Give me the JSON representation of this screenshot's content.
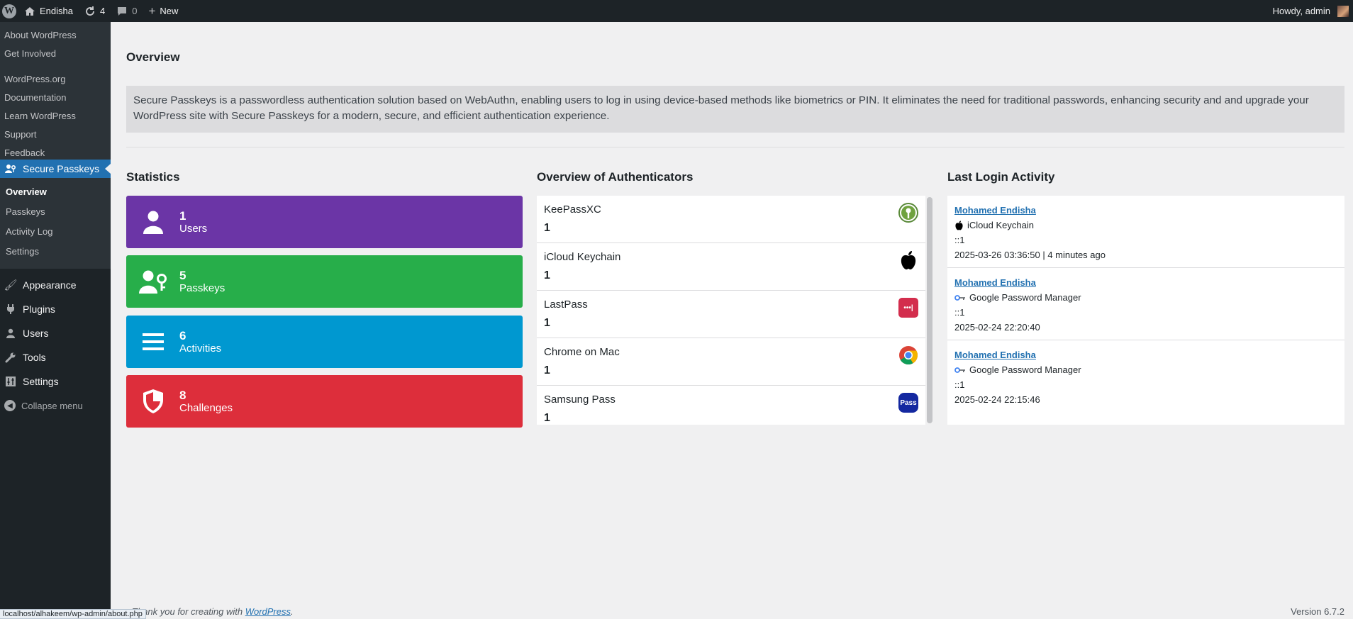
{
  "adminbar": {
    "site_name": "Endisha",
    "updates_count": "4",
    "comments_count": "0",
    "new_label": "New",
    "howdy": "Howdy, admin"
  },
  "sidebar": {
    "top_links": [
      "About WordPress",
      "Get Involved",
      "WordPress.org",
      "Documentation",
      "Learn WordPress",
      "Support",
      "Feedback"
    ],
    "active": "Secure Passkeys",
    "submenu": [
      "Overview",
      "Passkeys",
      "Activity Log",
      "Settings"
    ],
    "menu": [
      "Appearance",
      "Plugins",
      "Users",
      "Tools",
      "Settings"
    ],
    "collapse": "Collapse menu"
  },
  "page": {
    "title": "Overview",
    "description": "Secure Passkeys is a passwordless authentication solution based on WebAuthn, enabling users to log in using device-based methods like biometrics or PIN. It eliminates the need for traditional passwords, enhancing security and and upgrade your WordPress site with Secure Passkeys for a modern, secure, and efficient authentication experience."
  },
  "statistics": {
    "title": "Statistics",
    "cards": [
      {
        "value": "1",
        "label": "Users",
        "color": "#6b35a6",
        "icon": "user-icon"
      },
      {
        "value": "5",
        "label": "Passkeys",
        "color": "#27ae4a",
        "icon": "user-key-icon"
      },
      {
        "value": "6",
        "label": "Activities",
        "color": "#0098d0",
        "icon": "list-icon"
      },
      {
        "value": "8",
        "label": "Challenges",
        "color": "#dd2e3b",
        "icon": "shield-icon"
      }
    ]
  },
  "authenticators": {
    "title": "Overview of Authenticators",
    "items": [
      {
        "name": "KeePassXC",
        "count": "1",
        "icon": "keepassxc-icon"
      },
      {
        "name": "iCloud Keychain",
        "count": "1",
        "icon": "apple-icon"
      },
      {
        "name": "LastPass",
        "count": "1",
        "icon": "lastpass-icon",
        "icon_text": "•••|"
      },
      {
        "name": "Chrome on Mac",
        "count": "1",
        "icon": "chrome-icon"
      },
      {
        "name": "Samsung Pass",
        "count": "1",
        "icon": "samsung-pass-icon",
        "icon_text": "Pass"
      }
    ]
  },
  "last_login": {
    "title": "Last Login Activity",
    "items": [
      {
        "user": "Mohamed Endisha",
        "authenticator": "iCloud Keychain",
        "icon": "apple-icon",
        "ip": "::1",
        "time": "2025-03-26 03:36:50 | 4 minutes ago"
      },
      {
        "user": "Mohamed Endisha",
        "authenticator": "Google Password Manager",
        "icon": "key-icon",
        "ip": "::1",
        "time": "2025-02-24 22:20:40"
      },
      {
        "user": "Mohamed Endisha",
        "authenticator": "Google Password Manager",
        "icon": "key-icon",
        "ip": "::1",
        "time": "2025-02-24 22:15:46"
      }
    ]
  },
  "footer": {
    "thanks": "Thank you for creating with",
    "wp_link": "WordPress",
    "period": ".",
    "version": "Version 6.7.2",
    "status_url": "localhost/alhakeem/wp-admin/about.php"
  }
}
